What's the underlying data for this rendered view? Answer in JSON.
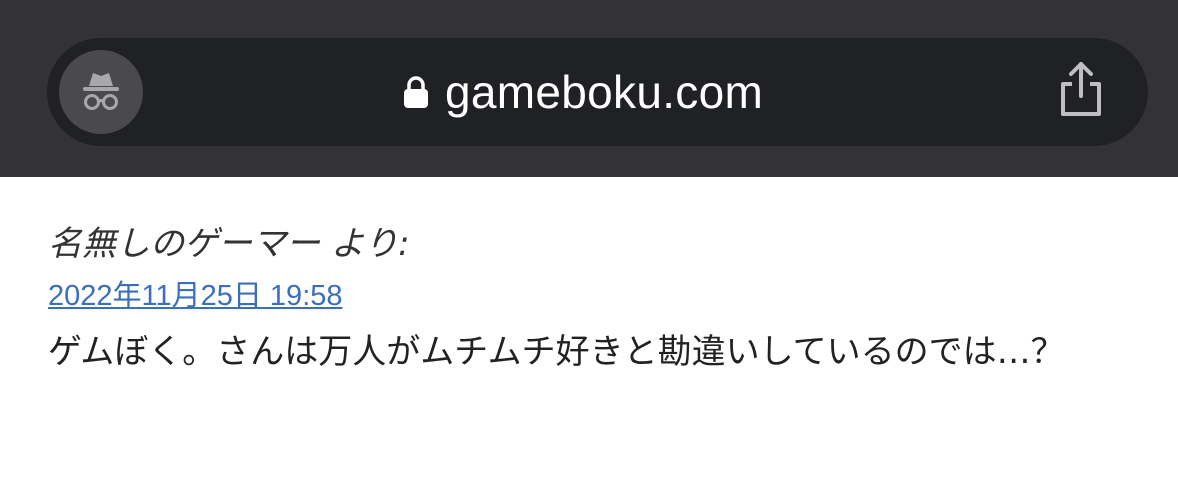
{
  "browser": {
    "domain": "gameboku.com",
    "colors": {
      "toolbar": "#333335",
      "urlbar": "#202124",
      "incognito_button": "#4a4a4e"
    },
    "icons": [
      "incognito-icon",
      "lock-icon",
      "share-icon"
    ]
  },
  "post": {
    "author": "名無しのゲーマー より:",
    "date": "2022年11月25日 19:58",
    "comment": "ゲムぼく。さんは万人がムチムチ好きと勘違いしているのでは…？",
    "link_color": "#3a6fbd"
  }
}
